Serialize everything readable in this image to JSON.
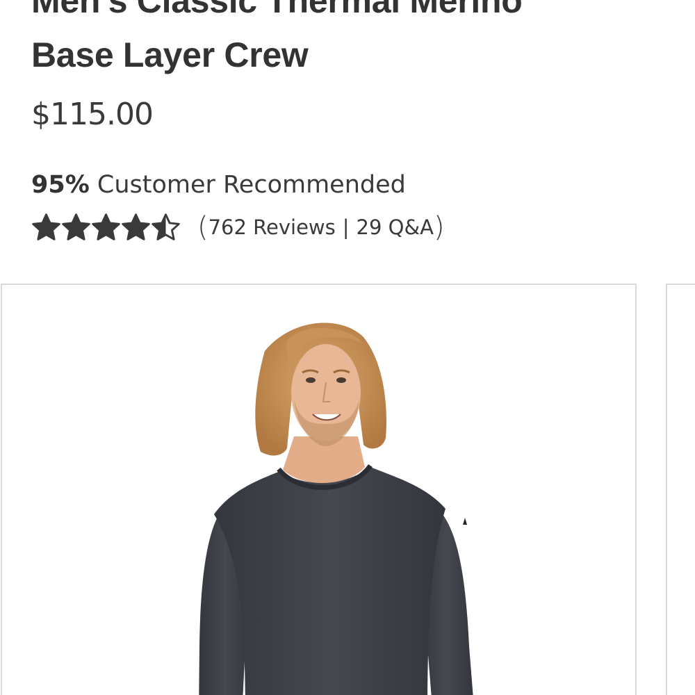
{
  "product": {
    "title_line1": "Men's Classic Thermal Merino",
    "title_line2": "Base Layer Crew",
    "price": "$115.00"
  },
  "recommendation": {
    "percent": "95%",
    "label": "Customer Recommended"
  },
  "rating": {
    "stars": 4.5,
    "max_stars": 5,
    "open_paren": "(",
    "reviews_text": "762 Reviews",
    "separator": "|",
    "qa_text": "29 Q&A",
    "close_paren": ")"
  },
  "gallery": {
    "main_image": "product-photo-man-wearing-charcoal-merino-crew",
    "shirt_color": "#3d4047",
    "hair_color": "#c8935a",
    "skin_color": "#e8b896",
    "border_color": "#d9d9d9"
  },
  "colors": {
    "text": "#3a3a3a",
    "star": "#3a3a3a"
  }
}
